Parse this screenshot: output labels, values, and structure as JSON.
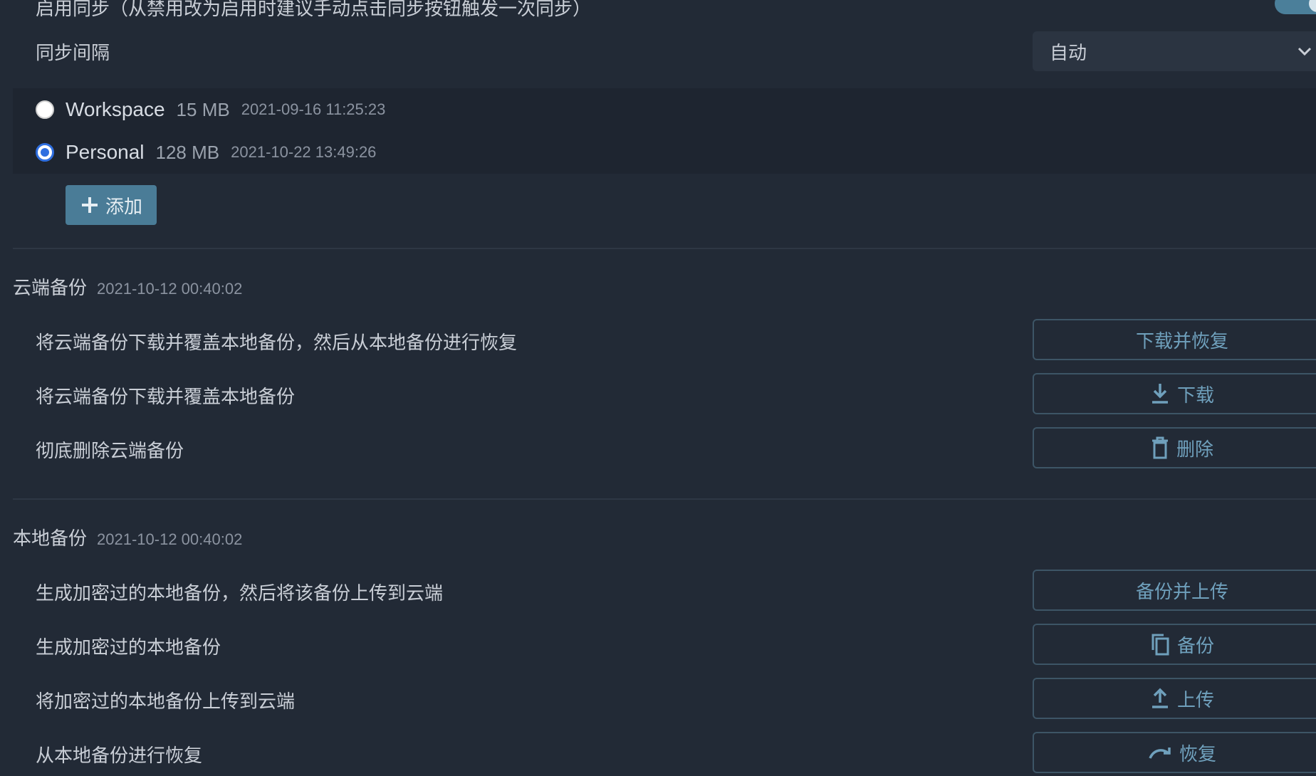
{
  "sync": {
    "enable_label": "启用同步（从禁用改为启用时建议手动点击同步按钮触发一次同步）",
    "interval_label": "同步间隔",
    "interval_value": "自动"
  },
  "profiles": [
    {
      "name": "Workspace",
      "size": "15 MB",
      "time": "2021-09-16 11:25:23",
      "selected": false
    },
    {
      "name": "Personal",
      "size": "128 MB",
      "time": "2021-10-22 13:49:26",
      "selected": true
    }
  ],
  "add_label": "添加",
  "cloud": {
    "title": "云端备份",
    "time": "2021-10-12 00:40:02",
    "rows": [
      {
        "label": "将云端备份下载并覆盖本地备份，然后从本地备份进行恢复",
        "button": "下载并恢复",
        "icon": "none"
      },
      {
        "label": "将云端备份下载并覆盖本地备份",
        "button": "下载",
        "icon": "download-icon"
      },
      {
        "label": "彻底删除云端备份",
        "button": "删除",
        "icon": "trash-icon"
      }
    ]
  },
  "local": {
    "title": "本地备份",
    "time": "2021-10-12 00:40:02",
    "rows": [
      {
        "label": "生成加密过的本地备份，然后将该备份上传到云端",
        "button": "备份并上传",
        "icon": "none"
      },
      {
        "label": "生成加密过的本地备份",
        "button": "备份",
        "icon": "copy-icon"
      },
      {
        "label": "将加密过的本地备份上传到云端",
        "button": "上传",
        "icon": "upload-icon"
      },
      {
        "label": "从本地备份进行恢复",
        "button": "恢复",
        "icon": "redo-icon"
      }
    ]
  },
  "colors": {
    "background": "#222a36",
    "accent": "#4a7c97",
    "button_text": "#6fa0bc",
    "radio_selected": "#2f6fe0"
  }
}
